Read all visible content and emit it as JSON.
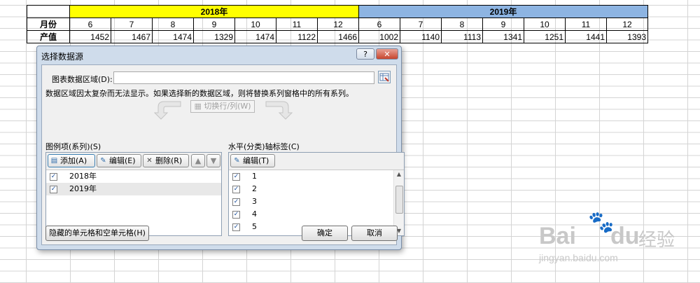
{
  "sheet": {
    "year_2018": "2018年",
    "year_2019": "2019年",
    "month_label": "月份",
    "output_label": "产值",
    "months": [
      "6",
      "7",
      "8",
      "9",
      "10",
      "11",
      "12",
      "6",
      "7",
      "8",
      "9",
      "10",
      "11",
      "12"
    ],
    "values": [
      "1452",
      "1467",
      "1474",
      "1329",
      "1474",
      "1122",
      "1466",
      "1002",
      "1140",
      "1113",
      "1341",
      "1251",
      "1441",
      "1393"
    ]
  },
  "dialog": {
    "title": "选择数据源",
    "help": "?",
    "close": "✕",
    "range_label": "图表数据区域(D):",
    "range_value": "",
    "notice": "数据区域因太复杂而无法显示。如果选择新的数据区域，则将替换系列窗格中的所有系列。",
    "switch_label": "切换行/列(W)",
    "series_label": "图例项(系列)(S)",
    "axis_label": "水平(分类)轴标签(C)",
    "add_label": "添加(A)",
    "edit_label": "编辑(E)",
    "delete_label": "删除(R)",
    "axis_edit_label": "编辑(T)",
    "series": [
      {
        "label": "2018年",
        "checked": "✓"
      },
      {
        "label": "2019年",
        "checked": "✓"
      }
    ],
    "axis_items": [
      {
        "label": "1",
        "checked": "✓"
      },
      {
        "label": "2",
        "checked": "✓"
      },
      {
        "label": "3",
        "checked": "✓"
      },
      {
        "label": "4",
        "checked": "✓"
      },
      {
        "label": "5",
        "checked": "✓"
      }
    ],
    "hidden_cells_label": "隐藏的单元格和空单元格(H)",
    "ok_label": "确定",
    "cancel_label": "取消"
  },
  "watermark": {
    "brand": "Bai",
    "brand2": "du",
    "suffix": "经验",
    "url": "jingyan.baidu.com"
  }
}
